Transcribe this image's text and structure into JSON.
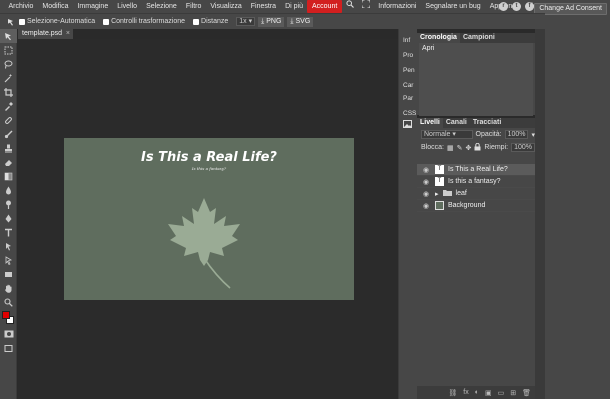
{
  "menu": {
    "items": [
      "Archivio",
      "Modifica",
      "Immagine",
      "Livello",
      "Selezione",
      "Filtro",
      "Visualizza",
      "Finestra",
      "Di più"
    ],
    "account": "Account",
    "extra": [
      "Informazioni",
      "Segnalare un bug",
      "Apprendi",
      "Blog",
      "API"
    ]
  },
  "ad_button": "Change Ad Consent",
  "options": {
    "auto_select": "Selezione-Automatica",
    "transform_controls": "Controlli trasformazione",
    "distances": "Distanze",
    "zoom": "1x",
    "png": "PNG",
    "svg": "SVG"
  },
  "document": {
    "tab": "template.psd",
    "close": "×"
  },
  "artboard": {
    "title": "Is This a Real Life?",
    "subtitle": "Is this a fantasy?",
    "bg": "#5f6d5e",
    "leaf": "#9aab95"
  },
  "side_buttons": [
    "Inf",
    "Pro",
    "Pen",
    "Car",
    "Par",
    "CSS"
  ],
  "history_panel": {
    "tabs": [
      "Cronologia",
      "Campioni"
    ],
    "entries": [
      "Apri"
    ]
  },
  "layers_panel": {
    "tabs": [
      "Livelli",
      "Canali",
      "Tracciati"
    ],
    "blend": "Normale",
    "opacity_label": "Opacità:",
    "opacity": "100%",
    "lock_label": "Blocca:",
    "fill_label": "Riempi:",
    "fill": "100%",
    "layers": [
      {
        "name": "Is This a Real Life?",
        "thumb": "T"
      },
      {
        "name": "Is this a fantasy?",
        "thumb": "T"
      },
      {
        "name": "leaf",
        "thumb": "▸"
      },
      {
        "name": "Background",
        "thumb": ""
      }
    ]
  },
  "colors": {
    "primary": "#e00000",
    "secondary": "#ffffff",
    "accent": "#d21f1f"
  }
}
